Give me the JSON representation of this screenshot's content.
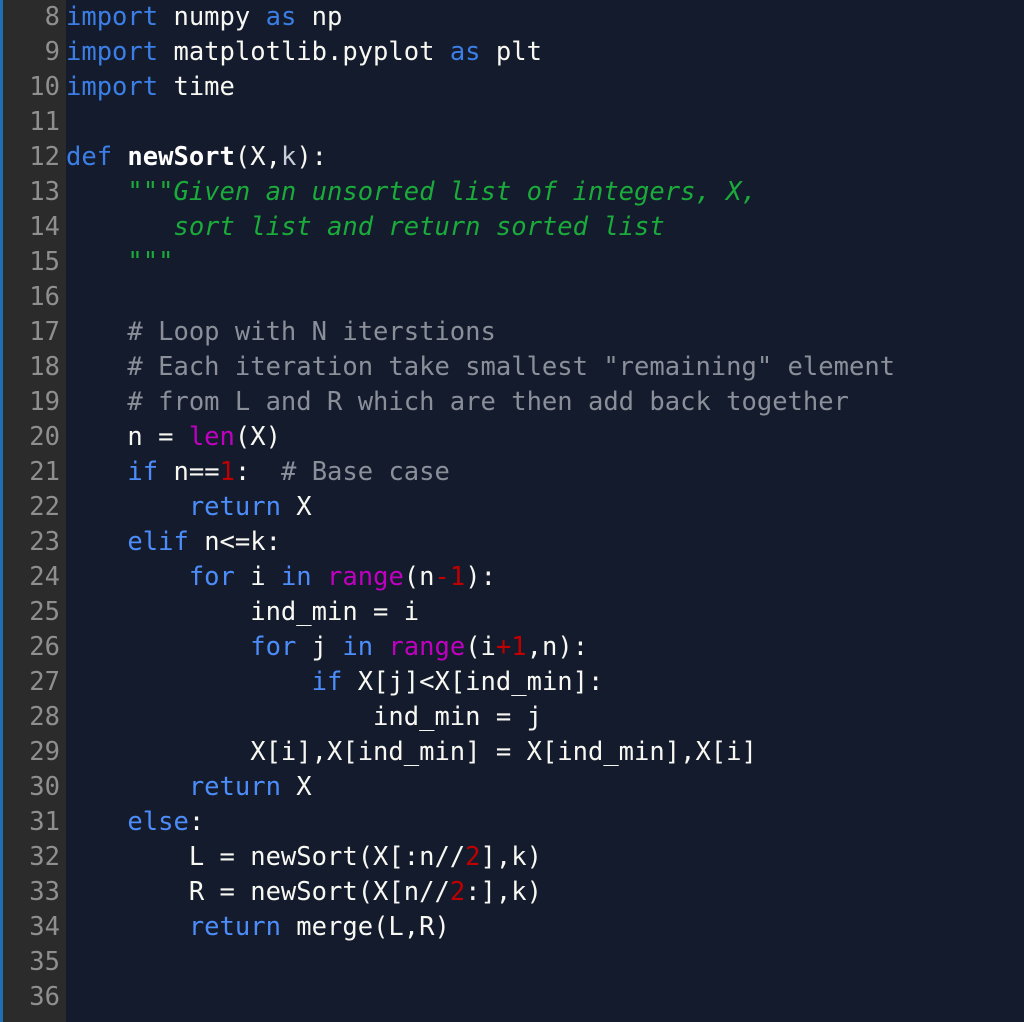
{
  "editor": {
    "language": "python",
    "background_color": "#141b2d",
    "gutter_color": "#2b2b2b",
    "accent_bar_color": "#1f6fb5",
    "first_visible_line": 8,
    "last_visible_line": 36,
    "colors": {
      "keyword": "#3b7fe6",
      "builtin_function": "#c000c0",
      "number": "#c00000",
      "string": "#1bab3a",
      "comment": "#8a8f99",
      "text": "#f8f8f2",
      "line_number": "#8f8f8f"
    }
  },
  "lines": [
    {
      "number": "8",
      "tokens": [
        {
          "t": "import",
          "c": "kw"
        },
        {
          "t": " numpy ",
          "c": "plain"
        },
        {
          "t": "as",
          "c": "kw"
        },
        {
          "t": " np",
          "c": "plain"
        }
      ]
    },
    {
      "number": "9",
      "tokens": [
        {
          "t": "import",
          "c": "kw"
        },
        {
          "t": " matplotlib.pyplot ",
          "c": "plain"
        },
        {
          "t": "as",
          "c": "kw"
        },
        {
          "t": " plt",
          "c": "plain"
        }
      ]
    },
    {
      "number": "10",
      "tokens": [
        {
          "t": "import",
          "c": "kw"
        },
        {
          "t": " time",
          "c": "plain"
        }
      ]
    },
    {
      "number": "11",
      "tokens": []
    },
    {
      "number": "12",
      "tokens": [
        {
          "t": "def",
          "c": "kw"
        },
        {
          "t": " ",
          "c": "plain"
        },
        {
          "t": "newSort",
          "c": "def"
        },
        {
          "t": "(",
          "c": "plain"
        },
        {
          "t": "X",
          "c": "plain"
        },
        {
          "t": ",",
          "c": "plain"
        },
        {
          "t": "k",
          "c": "param"
        },
        {
          "t": "):",
          "c": "plain"
        }
      ]
    },
    {
      "number": "13",
      "tokens": [
        {
          "t": "    \"\"\"Given an unsorted list of integers, X,",
          "c": "str"
        }
      ]
    },
    {
      "number": "14",
      "tokens": [
        {
          "t": "       sort list and return sorted list",
          "c": "str"
        }
      ]
    },
    {
      "number": "15",
      "tokens": [
        {
          "t": "    \"\"\"",
          "c": "str"
        }
      ]
    },
    {
      "number": "16",
      "tokens": []
    },
    {
      "number": "17",
      "tokens": [
        {
          "t": "    # Loop with N iterstions",
          "c": "com"
        }
      ]
    },
    {
      "number": "18",
      "tokens": [
        {
          "t": "    # Each iteration take smallest \"remaining\" element",
          "c": "com"
        }
      ]
    },
    {
      "number": "19",
      "tokens": [
        {
          "t": "    # from L and R which are then add back together",
          "c": "com"
        }
      ]
    },
    {
      "number": "20",
      "tokens": [
        {
          "t": "    n = ",
          "c": "plain"
        },
        {
          "t": "len",
          "c": "fn"
        },
        {
          "t": "(X)",
          "c": "plain"
        }
      ]
    },
    {
      "number": "21",
      "tokens": [
        {
          "t": "    ",
          "c": "plain"
        },
        {
          "t": "if",
          "c": "kw2"
        },
        {
          "t": " n==",
          "c": "plain"
        },
        {
          "t": "1",
          "c": "num"
        },
        {
          "t": ":  ",
          "c": "plain"
        },
        {
          "t": "# Base case",
          "c": "com"
        }
      ]
    },
    {
      "number": "22",
      "tokens": [
        {
          "t": "        ",
          "c": "plain"
        },
        {
          "t": "return",
          "c": "kw2"
        },
        {
          "t": " X",
          "c": "plain"
        }
      ]
    },
    {
      "number": "23",
      "tokens": [
        {
          "t": "    ",
          "c": "plain"
        },
        {
          "t": "elif",
          "c": "kw2"
        },
        {
          "t": " n<=k:",
          "c": "plain"
        }
      ]
    },
    {
      "number": "24",
      "tokens": [
        {
          "t": "        ",
          "c": "plain"
        },
        {
          "t": "for",
          "c": "kw2"
        },
        {
          "t": " i ",
          "c": "plain"
        },
        {
          "t": "in",
          "c": "kw2"
        },
        {
          "t": " ",
          "c": "plain"
        },
        {
          "t": "range",
          "c": "fn"
        },
        {
          "t": "(n",
          "c": "plain"
        },
        {
          "t": "-1",
          "c": "num"
        },
        {
          "t": "):",
          "c": "plain"
        }
      ]
    },
    {
      "number": "25",
      "tokens": [
        {
          "t": "            ind_min = i",
          "c": "plain"
        }
      ]
    },
    {
      "number": "26",
      "tokens": [
        {
          "t": "            ",
          "c": "plain"
        },
        {
          "t": "for",
          "c": "kw2"
        },
        {
          "t": " j ",
          "c": "plain"
        },
        {
          "t": "in",
          "c": "kw2"
        },
        {
          "t": " ",
          "c": "plain"
        },
        {
          "t": "range",
          "c": "fn"
        },
        {
          "t": "(i",
          "c": "plain"
        },
        {
          "t": "+1",
          "c": "num"
        },
        {
          "t": ",n):",
          "c": "plain"
        }
      ]
    },
    {
      "number": "27",
      "tokens": [
        {
          "t": "                ",
          "c": "plain"
        },
        {
          "t": "if",
          "c": "kw2"
        },
        {
          "t": " X[j]<X[ind_min]:",
          "c": "plain"
        }
      ]
    },
    {
      "number": "28",
      "tokens": [
        {
          "t": "                    ind_min = j",
          "c": "plain"
        }
      ]
    },
    {
      "number": "29",
      "tokens": [
        {
          "t": "            X[i],X[ind_min] = X[ind_min],X[i]",
          "c": "plain"
        }
      ]
    },
    {
      "number": "30",
      "tokens": [
        {
          "t": "        ",
          "c": "plain"
        },
        {
          "t": "return",
          "c": "kw2"
        },
        {
          "t": " X",
          "c": "plain"
        }
      ]
    },
    {
      "number": "31",
      "tokens": [
        {
          "t": "    ",
          "c": "plain"
        },
        {
          "t": "else",
          "c": "kw2"
        },
        {
          "t": ":",
          "c": "plain"
        }
      ]
    },
    {
      "number": "32",
      "tokens": [
        {
          "t": "        L = newSort(X[:n//",
          "c": "plain"
        },
        {
          "t": "2",
          "c": "num"
        },
        {
          "t": "],k)",
          "c": "plain"
        }
      ]
    },
    {
      "number": "33",
      "tokens": [
        {
          "t": "        R = newSort(X[n//",
          "c": "plain"
        },
        {
          "t": "2",
          "c": "num"
        },
        {
          "t": ":],k)",
          "c": "plain"
        }
      ]
    },
    {
      "number": "34",
      "tokens": [
        {
          "t": "        ",
          "c": "plain"
        },
        {
          "t": "return",
          "c": "kw2"
        },
        {
          "t": " merge(L,R)",
          "c": "plain"
        }
      ]
    },
    {
      "number": "35",
      "tokens": []
    },
    {
      "number": "36",
      "tokens": []
    }
  ]
}
